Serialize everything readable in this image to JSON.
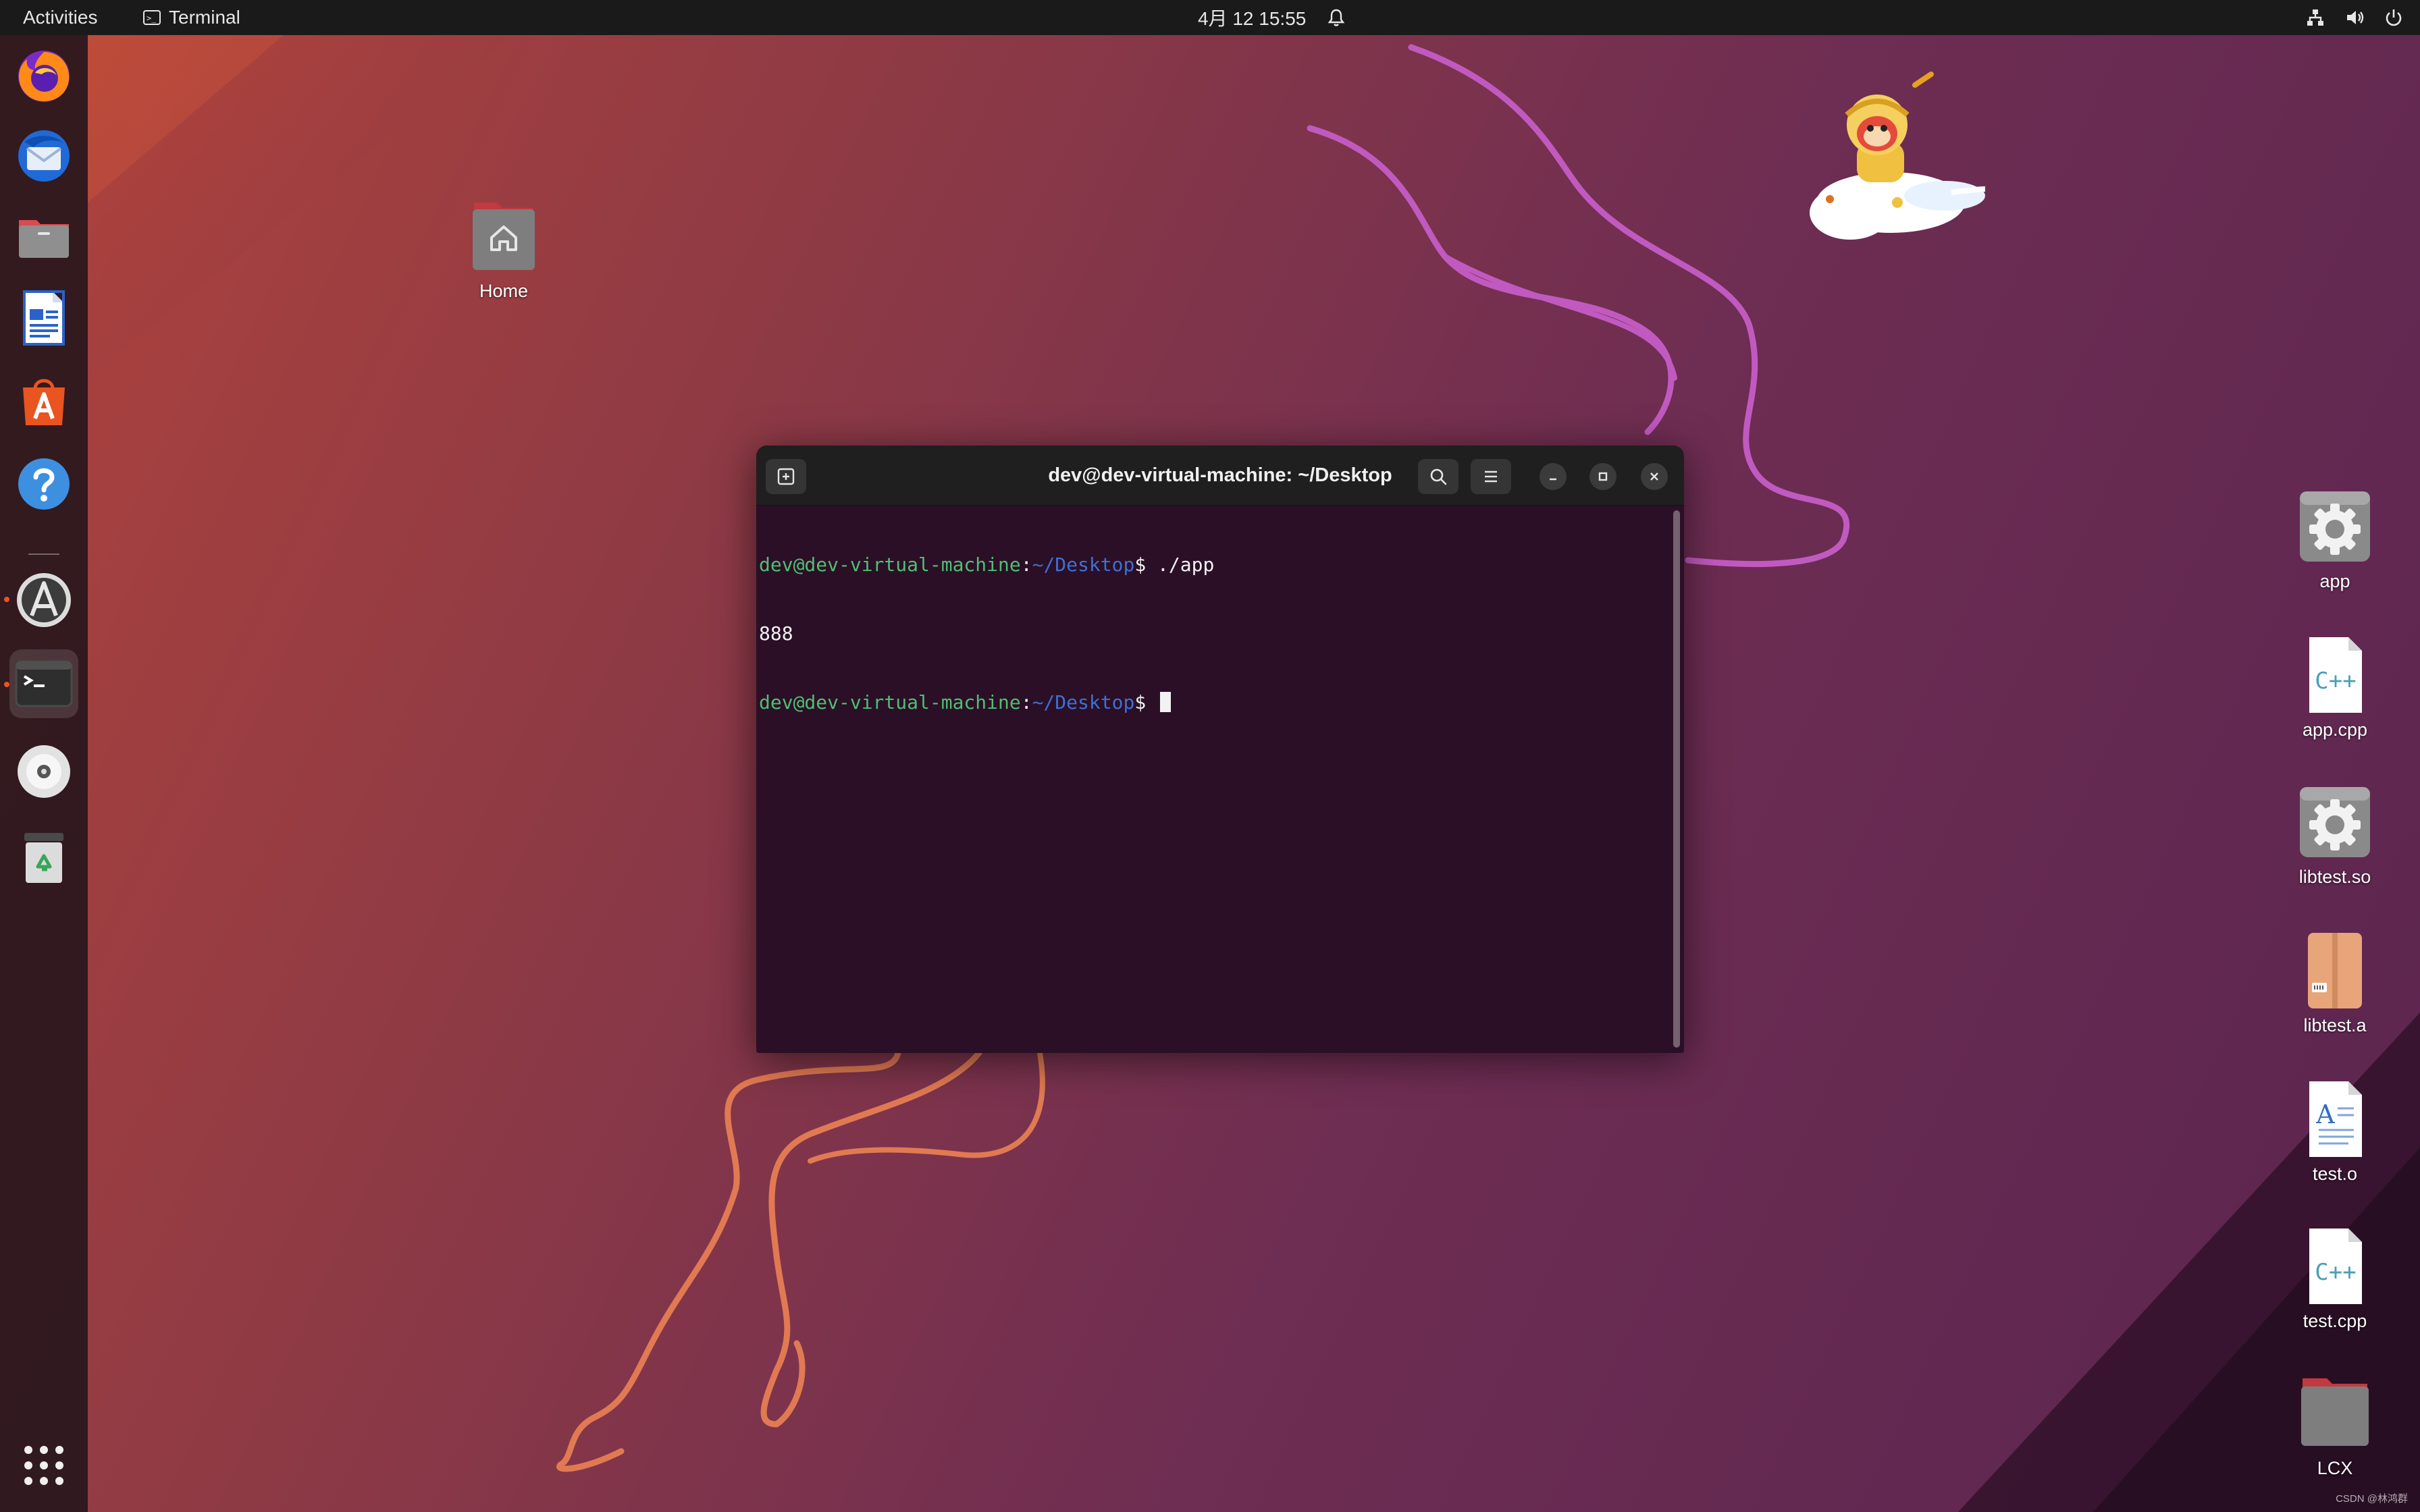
{
  "topbar": {
    "activities": "Activities",
    "app_name": "Terminal",
    "clock": "4月 12  15:55",
    "icons": [
      "network-icon",
      "volume-icon",
      "power-icon"
    ]
  },
  "dock": {
    "apps": [
      {
        "name": "Firefox",
        "icon": "firefox-icon"
      },
      {
        "name": "Thunderbird",
        "icon": "thunderbird-icon"
      },
      {
        "name": "Files",
        "icon": "files-icon"
      },
      {
        "name": "LibreOffice Writer",
        "icon": "writer-icon"
      },
      {
        "name": "App Center",
        "icon": "app-center-icon"
      },
      {
        "name": "Help",
        "icon": "help-icon"
      },
      {
        "name": "Software Updater",
        "icon": "updater-icon"
      },
      {
        "name": "Terminal",
        "icon": "terminal-icon"
      },
      {
        "name": "Disc",
        "icon": "disc-icon"
      },
      {
        "name": "Trash",
        "icon": "trash-icon"
      },
      {
        "name": "Show Applications",
        "icon": "app-grid-icon"
      }
    ]
  },
  "desktop": {
    "home_label": "Home",
    "files": [
      {
        "label": "app",
        "icon": "executable-gear-icon"
      },
      {
        "label": "app.cpp",
        "icon": "cpp-file-icon",
        "badge": "C++"
      },
      {
        "label": "libtest.so",
        "icon": "shared-library-gear-icon"
      },
      {
        "label": "libtest.a",
        "icon": "archive-icon"
      },
      {
        "label": "test.o",
        "icon": "object-file-icon",
        "badge": "A"
      },
      {
        "label": "test.cpp",
        "icon": "cpp-file-icon",
        "badge": "C++"
      },
      {
        "label": "LCX",
        "icon": "folder-icon"
      }
    ]
  },
  "terminal": {
    "title": "dev@dev-virtual-machine: ~/Desktop",
    "prompt_user": "dev@dev-virtual-machine",
    "prompt_sep": ":",
    "prompt_path": "~/Desktop",
    "prompt_sym": "$ ",
    "command": "./app",
    "output": "888"
  },
  "watermark": "CSDN @林鸿群",
  "colors": {
    "accent": "#e95420",
    "prompt_user": "#4fbf73",
    "prompt_path": "#3f6fd6",
    "terminal_bg": "#2b0f26"
  }
}
